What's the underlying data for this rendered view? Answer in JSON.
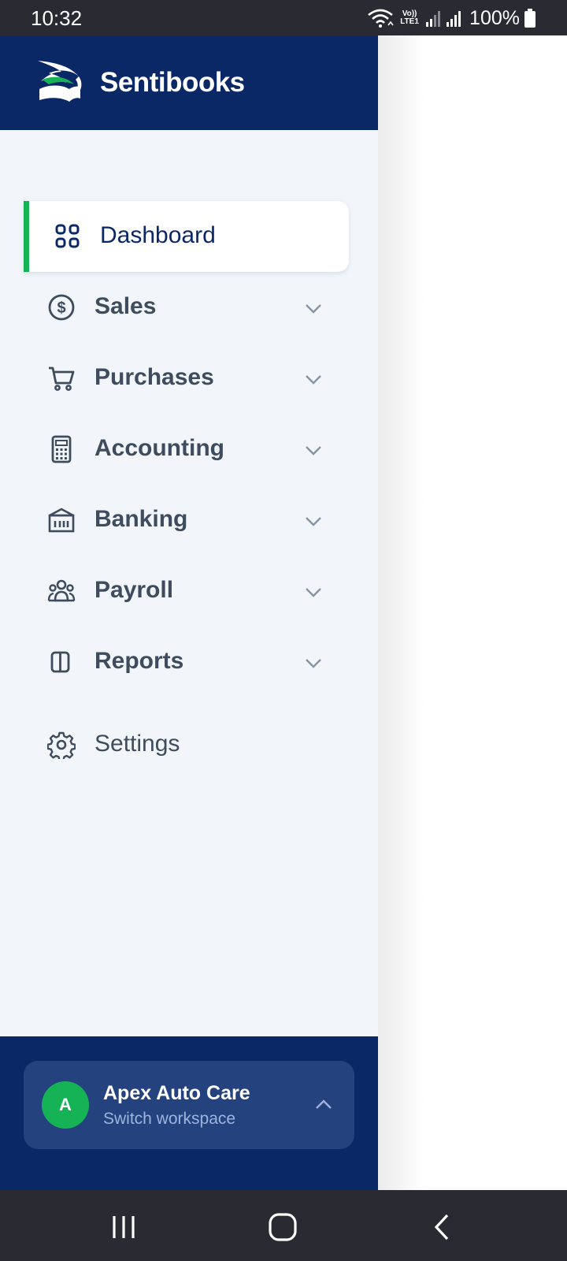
{
  "status_bar": {
    "time": "10:32",
    "volte_top": "Vo))",
    "volte_bottom": "LTE1",
    "battery": "100%"
  },
  "app": {
    "brand": "Sentibooks"
  },
  "nav": {
    "items": [
      {
        "label": "Dashboard",
        "icon": "grid-icon",
        "active": true
      },
      {
        "label": "Sales",
        "icon": "dollar-circle-icon",
        "expandable": true
      },
      {
        "label": "Purchases",
        "icon": "cart-icon",
        "expandable": true
      },
      {
        "label": "Accounting",
        "icon": "calculator-icon",
        "expandable": true
      },
      {
        "label": "Banking",
        "icon": "bank-icon",
        "expandable": true
      },
      {
        "label": "Payroll",
        "icon": "people-icon",
        "expandable": true
      },
      {
        "label": "Reports",
        "icon": "columns-icon",
        "expandable": true
      },
      {
        "label": "Settings",
        "icon": "gear-icon",
        "expandable": false
      }
    ]
  },
  "workspace": {
    "avatar_letter": "A",
    "name": "Apex Auto Care",
    "subtitle": "Switch workspace"
  },
  "colors": {
    "brand_navy": "#0b2866",
    "accent_green": "#16b356",
    "drawer_bg": "#f2f6fb",
    "text_muted": "#3e4c5e"
  }
}
